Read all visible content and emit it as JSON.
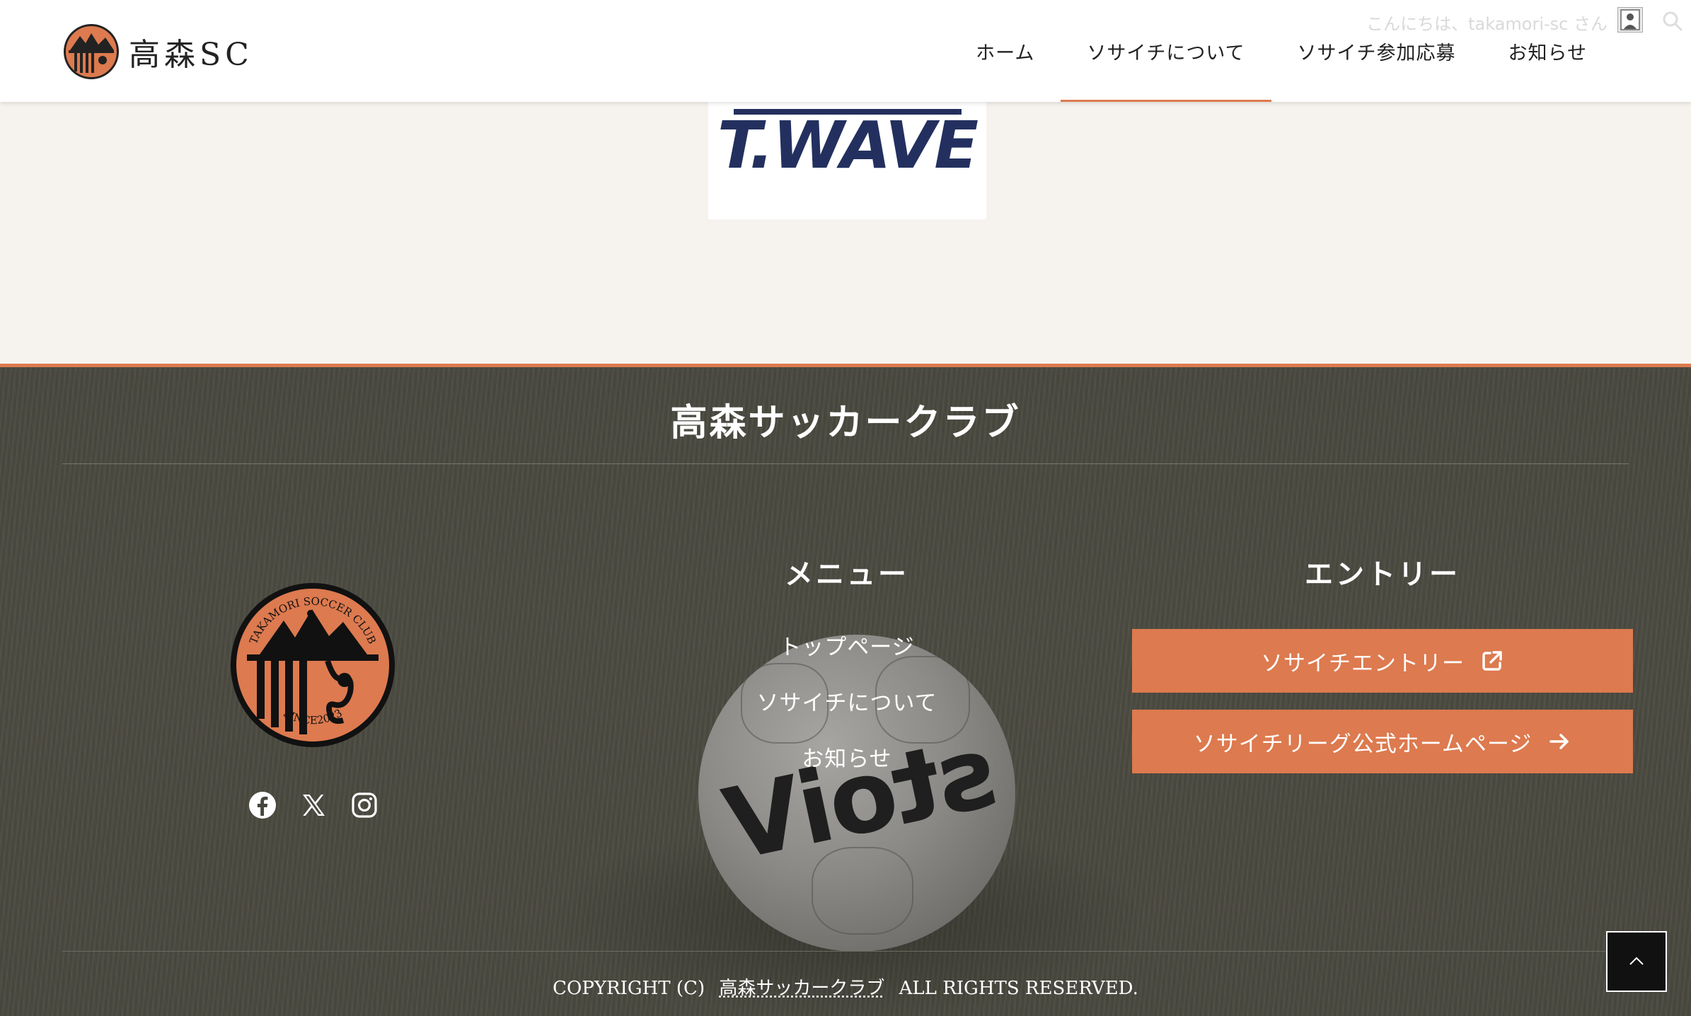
{
  "header": {
    "brand_name": "高森SC",
    "greeting": "こんにちは、takamori-sc さん",
    "nav": [
      {
        "label": "ホーム"
      },
      {
        "label": "ソサイチについて"
      },
      {
        "label": "ソサイチ参加応募"
      },
      {
        "label": "お知らせ"
      }
    ],
    "active_nav": "ソサイチについて"
  },
  "sponsor": {
    "logo_text": "T.WAVE"
  },
  "footer": {
    "title": "高森サッカークラブ",
    "emblem_text_top": "TAKAMORI SOCCER CLUB",
    "emblem_text_bottom": "SINCE2023",
    "social": [
      "facebook-icon",
      "x-icon",
      "instagram-icon"
    ],
    "menu_heading": "メニュー",
    "menu_links": [
      {
        "label": "トップページ"
      },
      {
        "label": "ソサイチについて"
      },
      {
        "label": "お知らせ"
      }
    ],
    "entry_heading": "エントリー",
    "entry_buttons": [
      {
        "label": "ソサイチエントリー",
        "icon": "external-link-icon"
      },
      {
        "label": "ソサイチリーグ公式ホームページ",
        "icon": "arrow-right-icon"
      }
    ],
    "copyright_prefix": "COPYRIGHT (C)",
    "copyright_link": "高森サッカークラブ",
    "copyright_suffix": "ALL RIGHTS RESERVED.",
    "ball_text": "stoiV"
  },
  "colors": {
    "accent": "#dd7a4f",
    "sponsor_navy": "#23305f",
    "header_bg": "#ffffff",
    "page_bg": "#f6f3ee"
  }
}
